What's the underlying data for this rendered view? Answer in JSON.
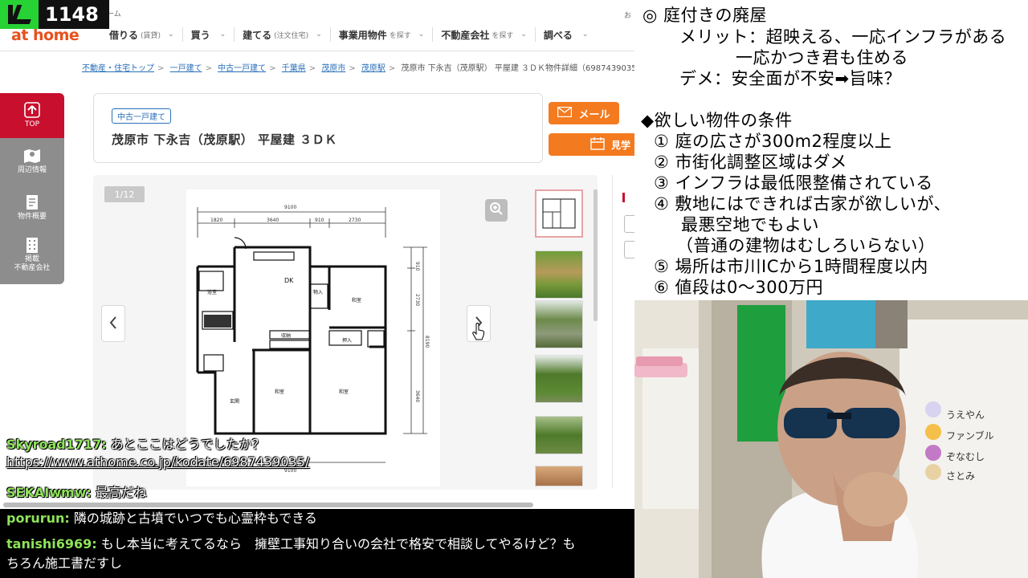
{
  "overlay": {
    "viewer_count": "1148"
  },
  "site": {
    "logo": "at home",
    "top_small": "ーム",
    "right_small": "お",
    "nav": [
      {
        "label": "借りる",
        "sub": "(賃貸)"
      },
      {
        "label": "買う",
        "sub": ""
      },
      {
        "label": "建てる",
        "sub": "(注文住宅)"
      },
      {
        "label": "事業用物件",
        "sub": "を探す"
      },
      {
        "label": "不動産会社",
        "sub": "を探す"
      },
      {
        "label": "調べる",
        "sub": ""
      }
    ]
  },
  "breadcrumb": [
    "不動産・住宅トップ",
    "一戸建て",
    "中古一戸建て",
    "千葉県",
    "茂原市",
    "茂原駅",
    "茂原市 下永吉（茂原駅） 平屋建 ３ＤＫ物件詳細（6987439035）"
  ],
  "sidebar": [
    {
      "label": "TOP",
      "icon": "up-arrow-icon"
    },
    {
      "label": "周辺情報",
      "icon": "map-icon"
    },
    {
      "label": "物件概要",
      "icon": "document-icon"
    },
    {
      "label": "掲載\n不動産会社",
      "icon": "building-icon"
    }
  ],
  "listing": {
    "badge": "中古一戸建て",
    "title": "茂原市 下永吉（茂原駅） 平屋建 ３ＤＫ",
    "mail_button": "メール",
    "visit_button": "見学"
  },
  "gallery": {
    "counter": "1/12",
    "floorplan": {
      "top_total": "9100",
      "top_dims": [
        "1820",
        "3640",
        "910",
        "2730"
      ],
      "right_dims": [
        "910",
        "2730",
        "8190",
        "3640"
      ],
      "bottom_total": "9100",
      "rooms": [
        "DK",
        "和室",
        "和室",
        "和室",
        "玄関",
        "浴室",
        "物入",
        "押入",
        "収納"
      ]
    }
  },
  "chat": {
    "overlay": [
      {
        "user": "Skyroad1717:",
        "text": "あとここはどうでしたか？"
      },
      {
        "user": "",
        "text": "https://www.athome.co.jp/kodate/6987439035/"
      },
      {
        "user": "SEKAIwmw:",
        "text": "最高だね"
      }
    ],
    "bottom": [
      {
        "user": "porurun:",
        "text": "隣の城跡と古墳でいつでも心霊枠もできる"
      },
      {
        "user": "tanishi6969:",
        "text": "もし本当に考えてるなら　擁壁工事知り合いの会社で格安で相談してやるけど？もちろん施工書だすし"
      }
    ]
  },
  "notes": {
    "lines": [
      "◎ 庭付きの廃屋",
      "メリット：超映える、一応インフラがある",
      "一応かつき君も住める",
      "デメ：安全面が不安➡旨味？",
      "◆欲しい物件の条件",
      "① 庭の広さが300m2程度以上",
      "② 市街化調整区域はダメ",
      "③ インフラは最低限整備されている",
      "④ 敷地にはできれば古家が欲しいが、",
      "最悪空地でもよい",
      "（普通の建物はむしろいらない）",
      "⑤ 場所は市川ICから1時間程度以内",
      "⑥ 値段は0～300万円"
    ]
  },
  "webcam": {
    "labels": [
      "うえやん",
      "ファンブル",
      "ぞなむし",
      "さとみ"
    ]
  },
  "colors": {
    "brand": "#e8501c",
    "accent_red": "#c8102e",
    "button_orange": "#f47a1f",
    "chat_user": "#8ee35a"
  }
}
